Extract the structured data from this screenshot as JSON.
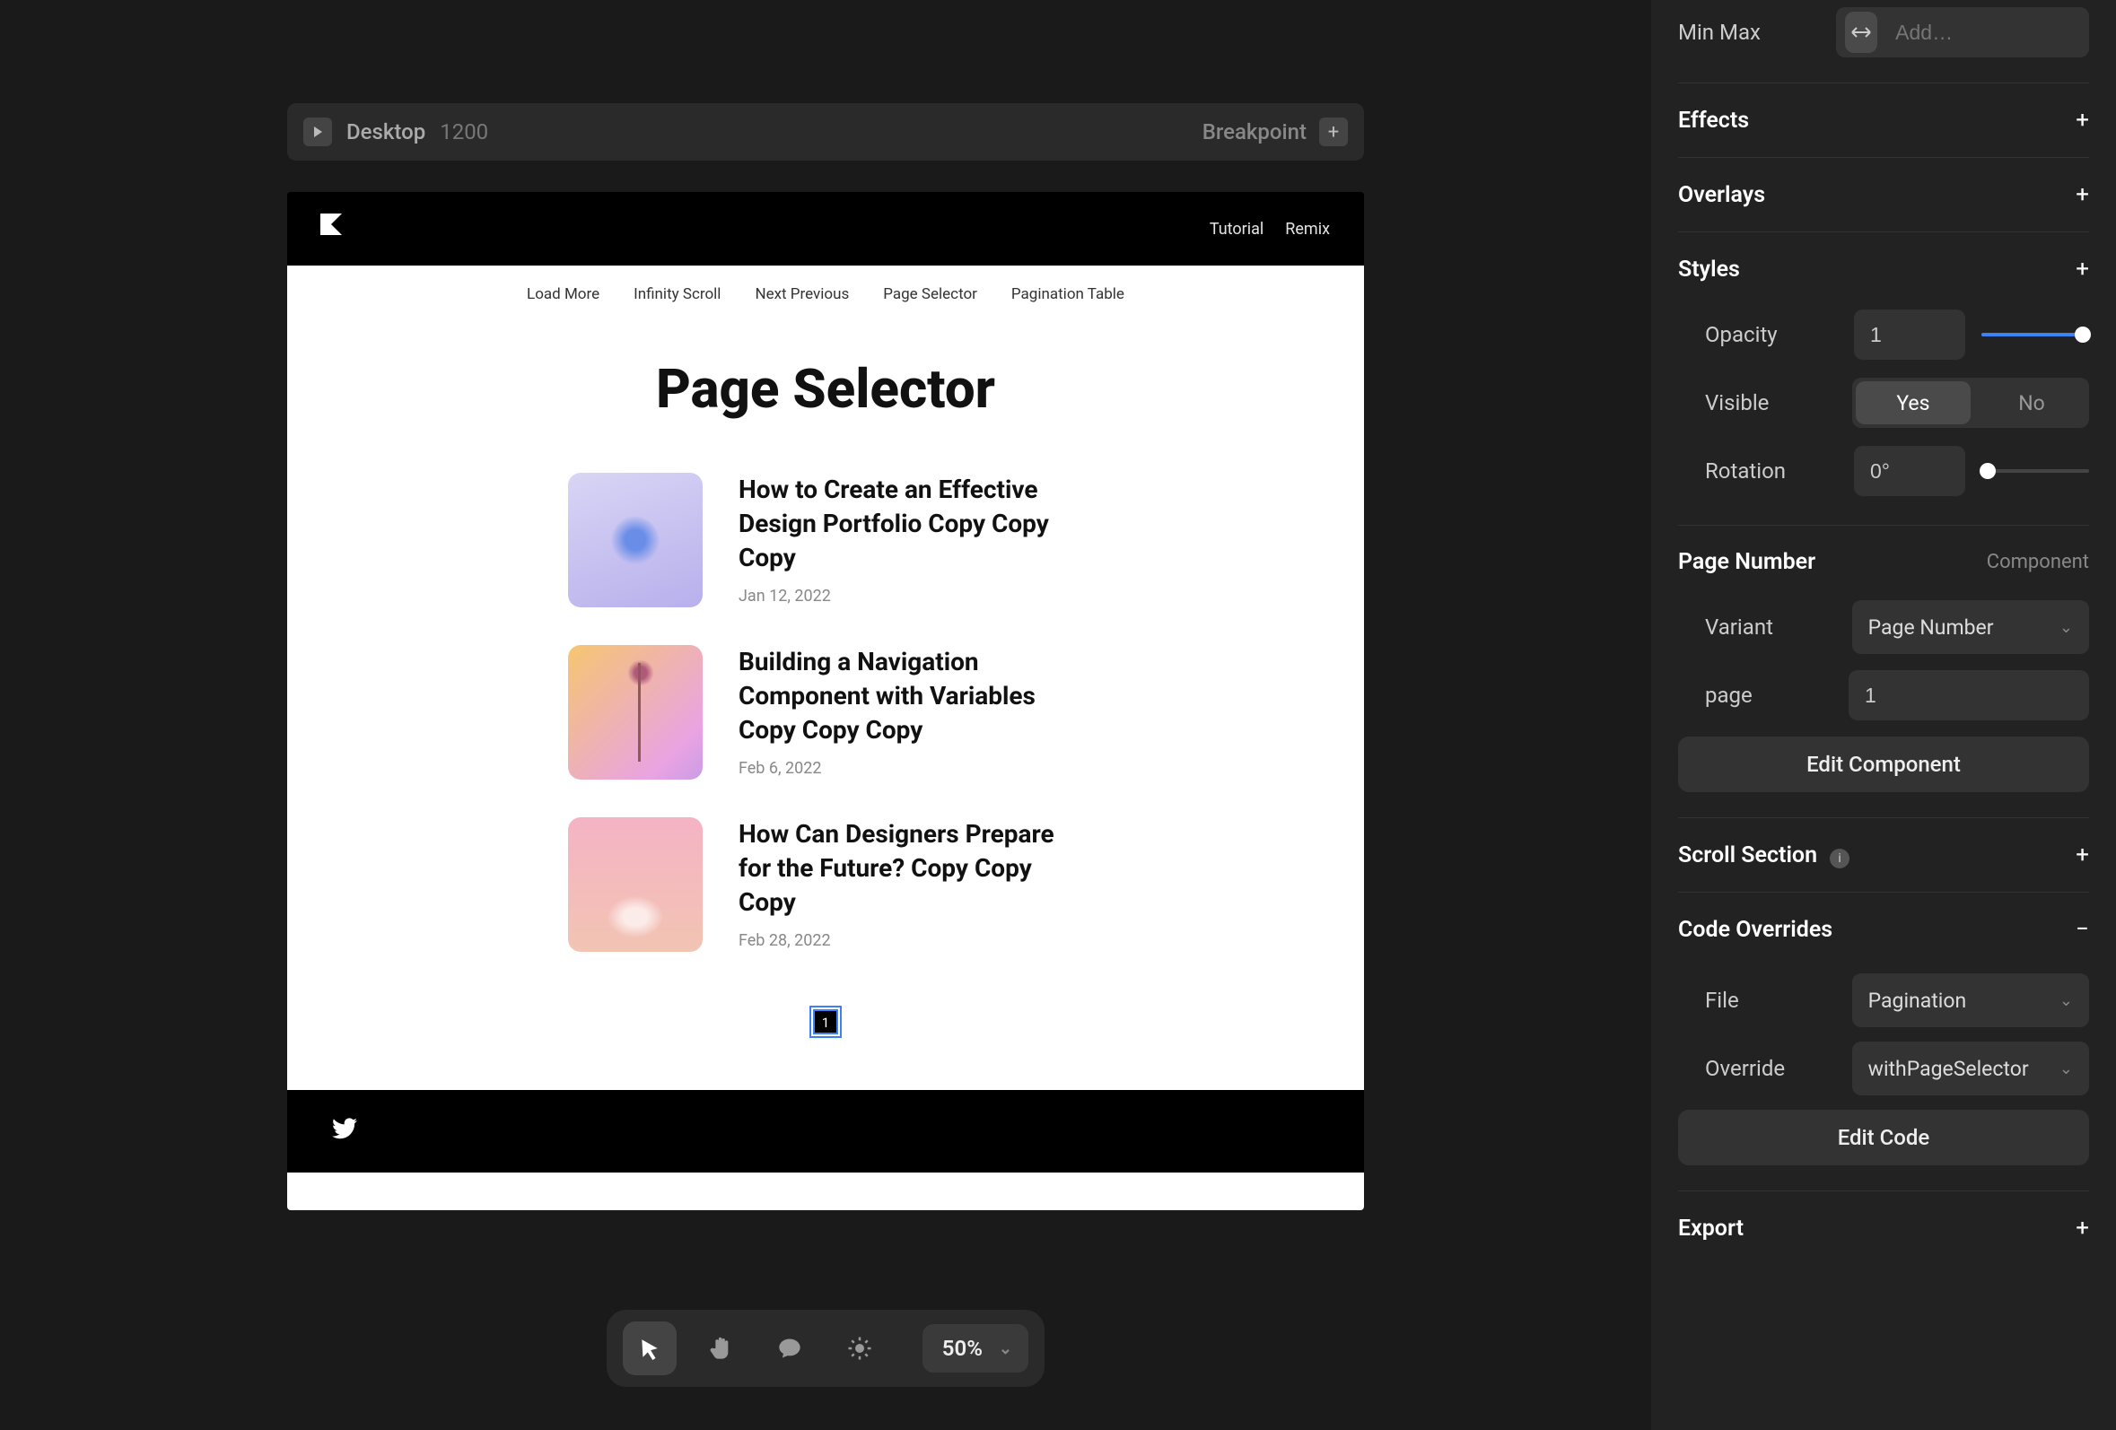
{
  "frame": {
    "device": "Desktop",
    "width": "1200",
    "breakpoint_label": "Breakpoint"
  },
  "site": {
    "nav": [
      "Tutorial",
      "Remix"
    ],
    "tabs": [
      "Load More",
      "Infinity Scroll",
      "Next Previous",
      "Page Selector",
      "Pagination Table"
    ],
    "title": "Page Selector",
    "posts": [
      {
        "title": "How to Create an Effective Design Portfolio Copy Copy Copy",
        "date": "Jan 12, 2022"
      },
      {
        "title": "Building a Navigation Component with Variables Copy Copy Copy",
        "date": "Feb 6, 2022"
      },
      {
        "title": "How Can Designers Prepare for the Future? Copy Copy Copy",
        "date": "Feb 28, 2022"
      }
    ],
    "page_number": "1"
  },
  "toolbar": {
    "zoom": "50%"
  },
  "inspector": {
    "minmax_label": "Min Max",
    "minmax_placeholder": "Add…",
    "sections": {
      "effects": "Effects",
      "overlays": "Overlays",
      "styles": "Styles",
      "page_number": "Page Number",
      "page_number_sub": "Component",
      "scroll_section": "Scroll Section",
      "code_overrides": "Code Overrides",
      "export": "Export"
    },
    "styles": {
      "opacity_label": "Opacity",
      "opacity_value": "1",
      "visible_label": "Visible",
      "visible_yes": "Yes",
      "visible_no": "No",
      "rotation_label": "Rotation",
      "rotation_value": "0°"
    },
    "page_number": {
      "variant_label": "Variant",
      "variant_value": "Page Number",
      "page_label": "page",
      "page_value": "1",
      "edit_component": "Edit Component"
    },
    "code_overrides": {
      "file_label": "File",
      "file_value": "Pagination",
      "override_label": "Override",
      "override_value": "withPageSelector",
      "edit_code": "Edit Code"
    }
  }
}
